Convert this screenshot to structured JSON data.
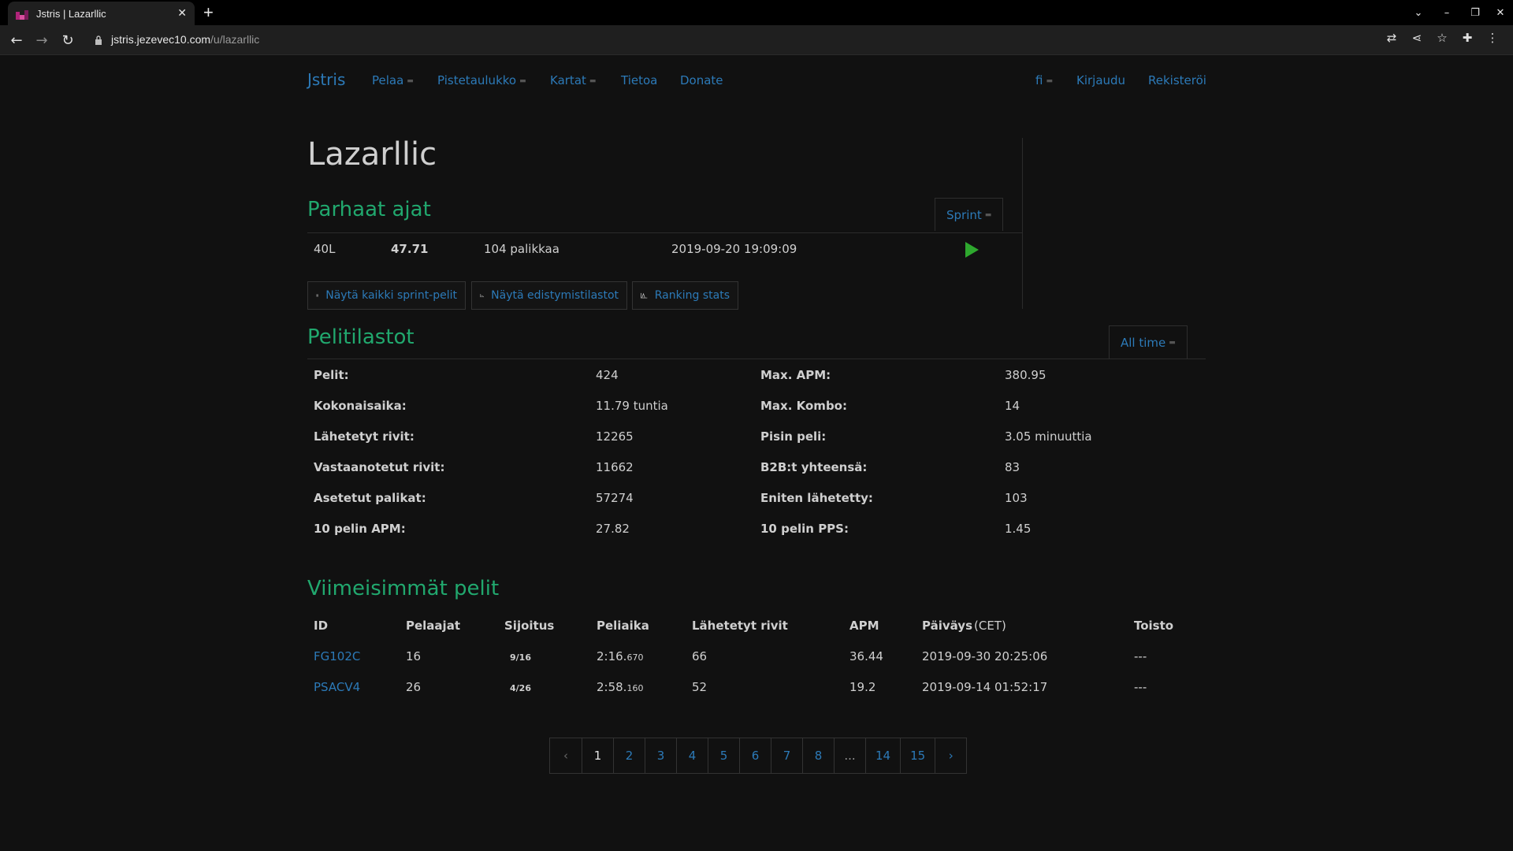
{
  "browser": {
    "tab_title": "Jstris | Lazarllic",
    "url_host": "jstris.jezevec10.com",
    "url_path": "/u/lazarllic"
  },
  "nav": {
    "brand": "Jstris",
    "items": [
      "Pelaa",
      "Pistetaulukko",
      "Kartat",
      "Tietoa",
      "Donate"
    ],
    "lang": "fi",
    "login": "Kirjaudu",
    "register": "Rekisteröi"
  },
  "profile": {
    "username": "Lazarllic"
  },
  "best_times": {
    "heading": "Parhaat ajat",
    "mode_select": "Sprint",
    "row": {
      "mode": "40L",
      "time": "47.71",
      "pieces": "104 palikkaa",
      "date": "2019-09-20 19:09:09"
    },
    "buttons": [
      "Näytä kaikki sprint-pelit",
      "Näytä edistymistilastot",
      "Ranking stats"
    ]
  },
  "stats": {
    "heading": "Pelitilastot",
    "period_select": "All time",
    "left": [
      {
        "label": "Pelit:",
        "value": "424"
      },
      {
        "label": "Kokonaisaika:",
        "value": "11.79 tuntia"
      },
      {
        "label": "Lähetetyt rivit:",
        "value": "12265"
      },
      {
        "label": "Vastaanotetut rivit:",
        "value": "11662"
      },
      {
        "label": "Asetetut palikat:",
        "value": "57274"
      },
      {
        "label": "10 pelin APM:",
        "value": "27.82"
      }
    ],
    "right": [
      {
        "label": "Max. APM:",
        "value": "380.95"
      },
      {
        "label": "Max. Kombo:",
        "value": "14"
      },
      {
        "label": "Pisin peli:",
        "value": "3.05 minuuttia"
      },
      {
        "label": "B2B:t yhteensä:",
        "value": "83"
      },
      {
        "label": "Eniten lähetetty:",
        "value": "103"
      },
      {
        "label": "10 pelin PPS:",
        "value": "1.45"
      }
    ]
  },
  "recent": {
    "heading": "Viimeisimmät pelit",
    "columns": [
      "ID",
      "Pelaajat",
      "Sijoitus",
      "Peliaika",
      "Lähetetyt rivit",
      "APM",
      "Päiväys",
      "(CET)",
      "Toisto"
    ],
    "rows": [
      {
        "id": "FG102C",
        "players": "16",
        "rank": "9/16",
        "time_main": "2:16.",
        "time_ms": "670",
        "lines": "66",
        "apm": "36.44",
        "date": "2019-09-30 20:25:06",
        "replay": "---"
      },
      {
        "id": "PSACV4",
        "players": "26",
        "rank": "4/26",
        "time_main": "2:58.",
        "time_ms": "160",
        "lines": "52",
        "apm": "19.2",
        "date": "2019-09-14 01:52:17",
        "replay": "---"
      }
    ]
  },
  "pagination": {
    "prev": "‹",
    "pages": [
      "1",
      "2",
      "3",
      "4",
      "5",
      "6",
      "7",
      "8",
      "...",
      "14",
      "15"
    ],
    "next": "›",
    "current": "1"
  },
  "colors": {
    "accent_green": "#21a86e",
    "link_blue": "#2c7ab8",
    "play_green": "#2ea82e",
    "background": "#111111"
  }
}
